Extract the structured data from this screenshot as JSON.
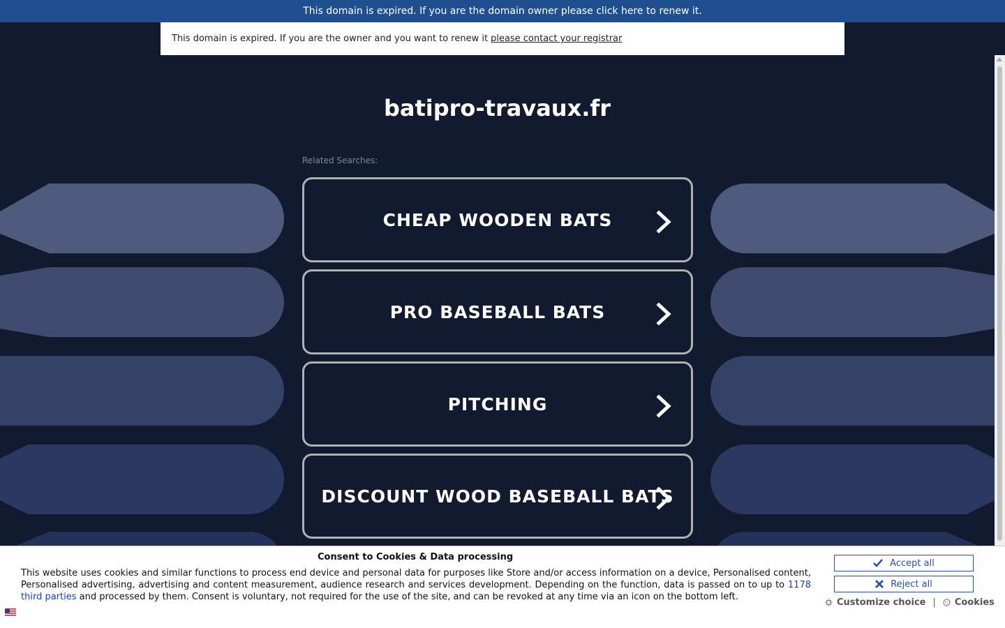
{
  "banner": {
    "text": "This domain is expired. If you are the domain owner please click here to renew it."
  },
  "notice": {
    "text": "This domain is expired. If you are the owner and you want to renew it",
    "link_text": "please contact your registrar"
  },
  "domain": "batipro-travaux.fr",
  "related_label": "Related Searches:",
  "searches": [
    "CHEAP WOODEN BATS",
    "PRO BASEBALL BATS",
    "PITCHING",
    "DISCOUNT WOOD BASEBALL BATS"
  ],
  "consent": {
    "title": "Consent to Cookies & Data processing",
    "text_before": "This website uses cookies and similar functions to process end device and personal data for purposes like Store and/or access information on a device, Personalised content, Personalised advertising, advertising and content measurement, audience research and services development. Depending on the function, data is passed on to up to",
    "third_parties_link": "1178 third parties",
    "text_after": "and processed by them. Consent is voluntary, not required for the use of the site, and can be revoked at any time via an icon on the bottom left.",
    "accept_label": "Accept all",
    "reject_label": "Reject all",
    "customize_label": "Customize choice",
    "separator": "|",
    "cookies_label": "Cookies"
  },
  "icons": {
    "chevron": "chevron-right-icon",
    "check": "check-icon",
    "close": "close-icon",
    "gear": "gear-icon",
    "cookie": "cookie-icon",
    "flag": "us-flag-icon"
  },
  "colors": {
    "background": "#111a2e",
    "banner": "#1f4f8e",
    "button_border": "#b1b1b1",
    "consent_accent": "#2a4fa8"
  }
}
